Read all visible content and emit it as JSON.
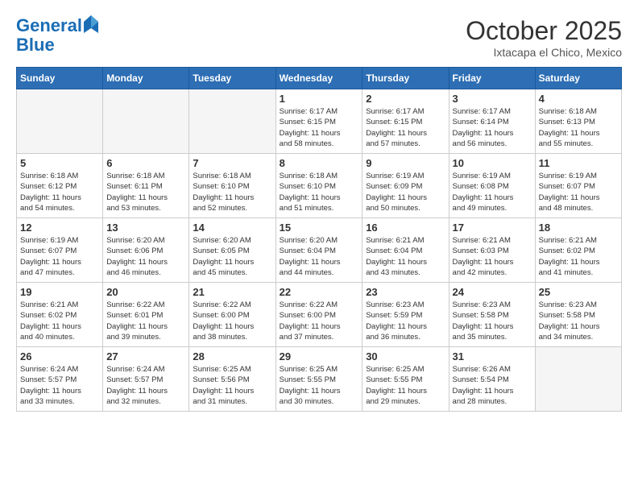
{
  "logo": {
    "line1": "General",
    "line2": "Blue"
  },
  "header": {
    "month": "October 2025",
    "location": "Ixtacapa el Chico, Mexico"
  },
  "weekdays": [
    "Sunday",
    "Monday",
    "Tuesday",
    "Wednesday",
    "Thursday",
    "Friday",
    "Saturday"
  ],
  "weeks": [
    [
      {
        "day": "",
        "info": ""
      },
      {
        "day": "",
        "info": ""
      },
      {
        "day": "",
        "info": ""
      },
      {
        "day": "1",
        "info": "Sunrise: 6:17 AM\nSunset: 6:15 PM\nDaylight: 11 hours\nand 58 minutes."
      },
      {
        "day": "2",
        "info": "Sunrise: 6:17 AM\nSunset: 6:15 PM\nDaylight: 11 hours\nand 57 minutes."
      },
      {
        "day": "3",
        "info": "Sunrise: 6:17 AM\nSunset: 6:14 PM\nDaylight: 11 hours\nand 56 minutes."
      },
      {
        "day": "4",
        "info": "Sunrise: 6:18 AM\nSunset: 6:13 PM\nDaylight: 11 hours\nand 55 minutes."
      }
    ],
    [
      {
        "day": "5",
        "info": "Sunrise: 6:18 AM\nSunset: 6:12 PM\nDaylight: 11 hours\nand 54 minutes."
      },
      {
        "day": "6",
        "info": "Sunrise: 6:18 AM\nSunset: 6:11 PM\nDaylight: 11 hours\nand 53 minutes."
      },
      {
        "day": "7",
        "info": "Sunrise: 6:18 AM\nSunset: 6:10 PM\nDaylight: 11 hours\nand 52 minutes."
      },
      {
        "day": "8",
        "info": "Sunrise: 6:18 AM\nSunset: 6:10 PM\nDaylight: 11 hours\nand 51 minutes."
      },
      {
        "day": "9",
        "info": "Sunrise: 6:19 AM\nSunset: 6:09 PM\nDaylight: 11 hours\nand 50 minutes."
      },
      {
        "day": "10",
        "info": "Sunrise: 6:19 AM\nSunset: 6:08 PM\nDaylight: 11 hours\nand 49 minutes."
      },
      {
        "day": "11",
        "info": "Sunrise: 6:19 AM\nSunset: 6:07 PM\nDaylight: 11 hours\nand 48 minutes."
      }
    ],
    [
      {
        "day": "12",
        "info": "Sunrise: 6:19 AM\nSunset: 6:07 PM\nDaylight: 11 hours\nand 47 minutes."
      },
      {
        "day": "13",
        "info": "Sunrise: 6:20 AM\nSunset: 6:06 PM\nDaylight: 11 hours\nand 46 minutes."
      },
      {
        "day": "14",
        "info": "Sunrise: 6:20 AM\nSunset: 6:05 PM\nDaylight: 11 hours\nand 45 minutes."
      },
      {
        "day": "15",
        "info": "Sunrise: 6:20 AM\nSunset: 6:04 PM\nDaylight: 11 hours\nand 44 minutes."
      },
      {
        "day": "16",
        "info": "Sunrise: 6:21 AM\nSunset: 6:04 PM\nDaylight: 11 hours\nand 43 minutes."
      },
      {
        "day": "17",
        "info": "Sunrise: 6:21 AM\nSunset: 6:03 PM\nDaylight: 11 hours\nand 42 minutes."
      },
      {
        "day": "18",
        "info": "Sunrise: 6:21 AM\nSunset: 6:02 PM\nDaylight: 11 hours\nand 41 minutes."
      }
    ],
    [
      {
        "day": "19",
        "info": "Sunrise: 6:21 AM\nSunset: 6:02 PM\nDaylight: 11 hours\nand 40 minutes."
      },
      {
        "day": "20",
        "info": "Sunrise: 6:22 AM\nSunset: 6:01 PM\nDaylight: 11 hours\nand 39 minutes."
      },
      {
        "day": "21",
        "info": "Sunrise: 6:22 AM\nSunset: 6:00 PM\nDaylight: 11 hours\nand 38 minutes."
      },
      {
        "day": "22",
        "info": "Sunrise: 6:22 AM\nSunset: 6:00 PM\nDaylight: 11 hours\nand 37 minutes."
      },
      {
        "day": "23",
        "info": "Sunrise: 6:23 AM\nSunset: 5:59 PM\nDaylight: 11 hours\nand 36 minutes."
      },
      {
        "day": "24",
        "info": "Sunrise: 6:23 AM\nSunset: 5:58 PM\nDaylight: 11 hours\nand 35 minutes."
      },
      {
        "day": "25",
        "info": "Sunrise: 6:23 AM\nSunset: 5:58 PM\nDaylight: 11 hours\nand 34 minutes."
      }
    ],
    [
      {
        "day": "26",
        "info": "Sunrise: 6:24 AM\nSunset: 5:57 PM\nDaylight: 11 hours\nand 33 minutes."
      },
      {
        "day": "27",
        "info": "Sunrise: 6:24 AM\nSunset: 5:57 PM\nDaylight: 11 hours\nand 32 minutes."
      },
      {
        "day": "28",
        "info": "Sunrise: 6:25 AM\nSunset: 5:56 PM\nDaylight: 11 hours\nand 31 minutes."
      },
      {
        "day": "29",
        "info": "Sunrise: 6:25 AM\nSunset: 5:55 PM\nDaylight: 11 hours\nand 30 minutes."
      },
      {
        "day": "30",
        "info": "Sunrise: 6:25 AM\nSunset: 5:55 PM\nDaylight: 11 hours\nand 29 minutes."
      },
      {
        "day": "31",
        "info": "Sunrise: 6:26 AM\nSunset: 5:54 PM\nDaylight: 11 hours\nand 28 minutes."
      },
      {
        "day": "",
        "info": ""
      }
    ]
  ]
}
